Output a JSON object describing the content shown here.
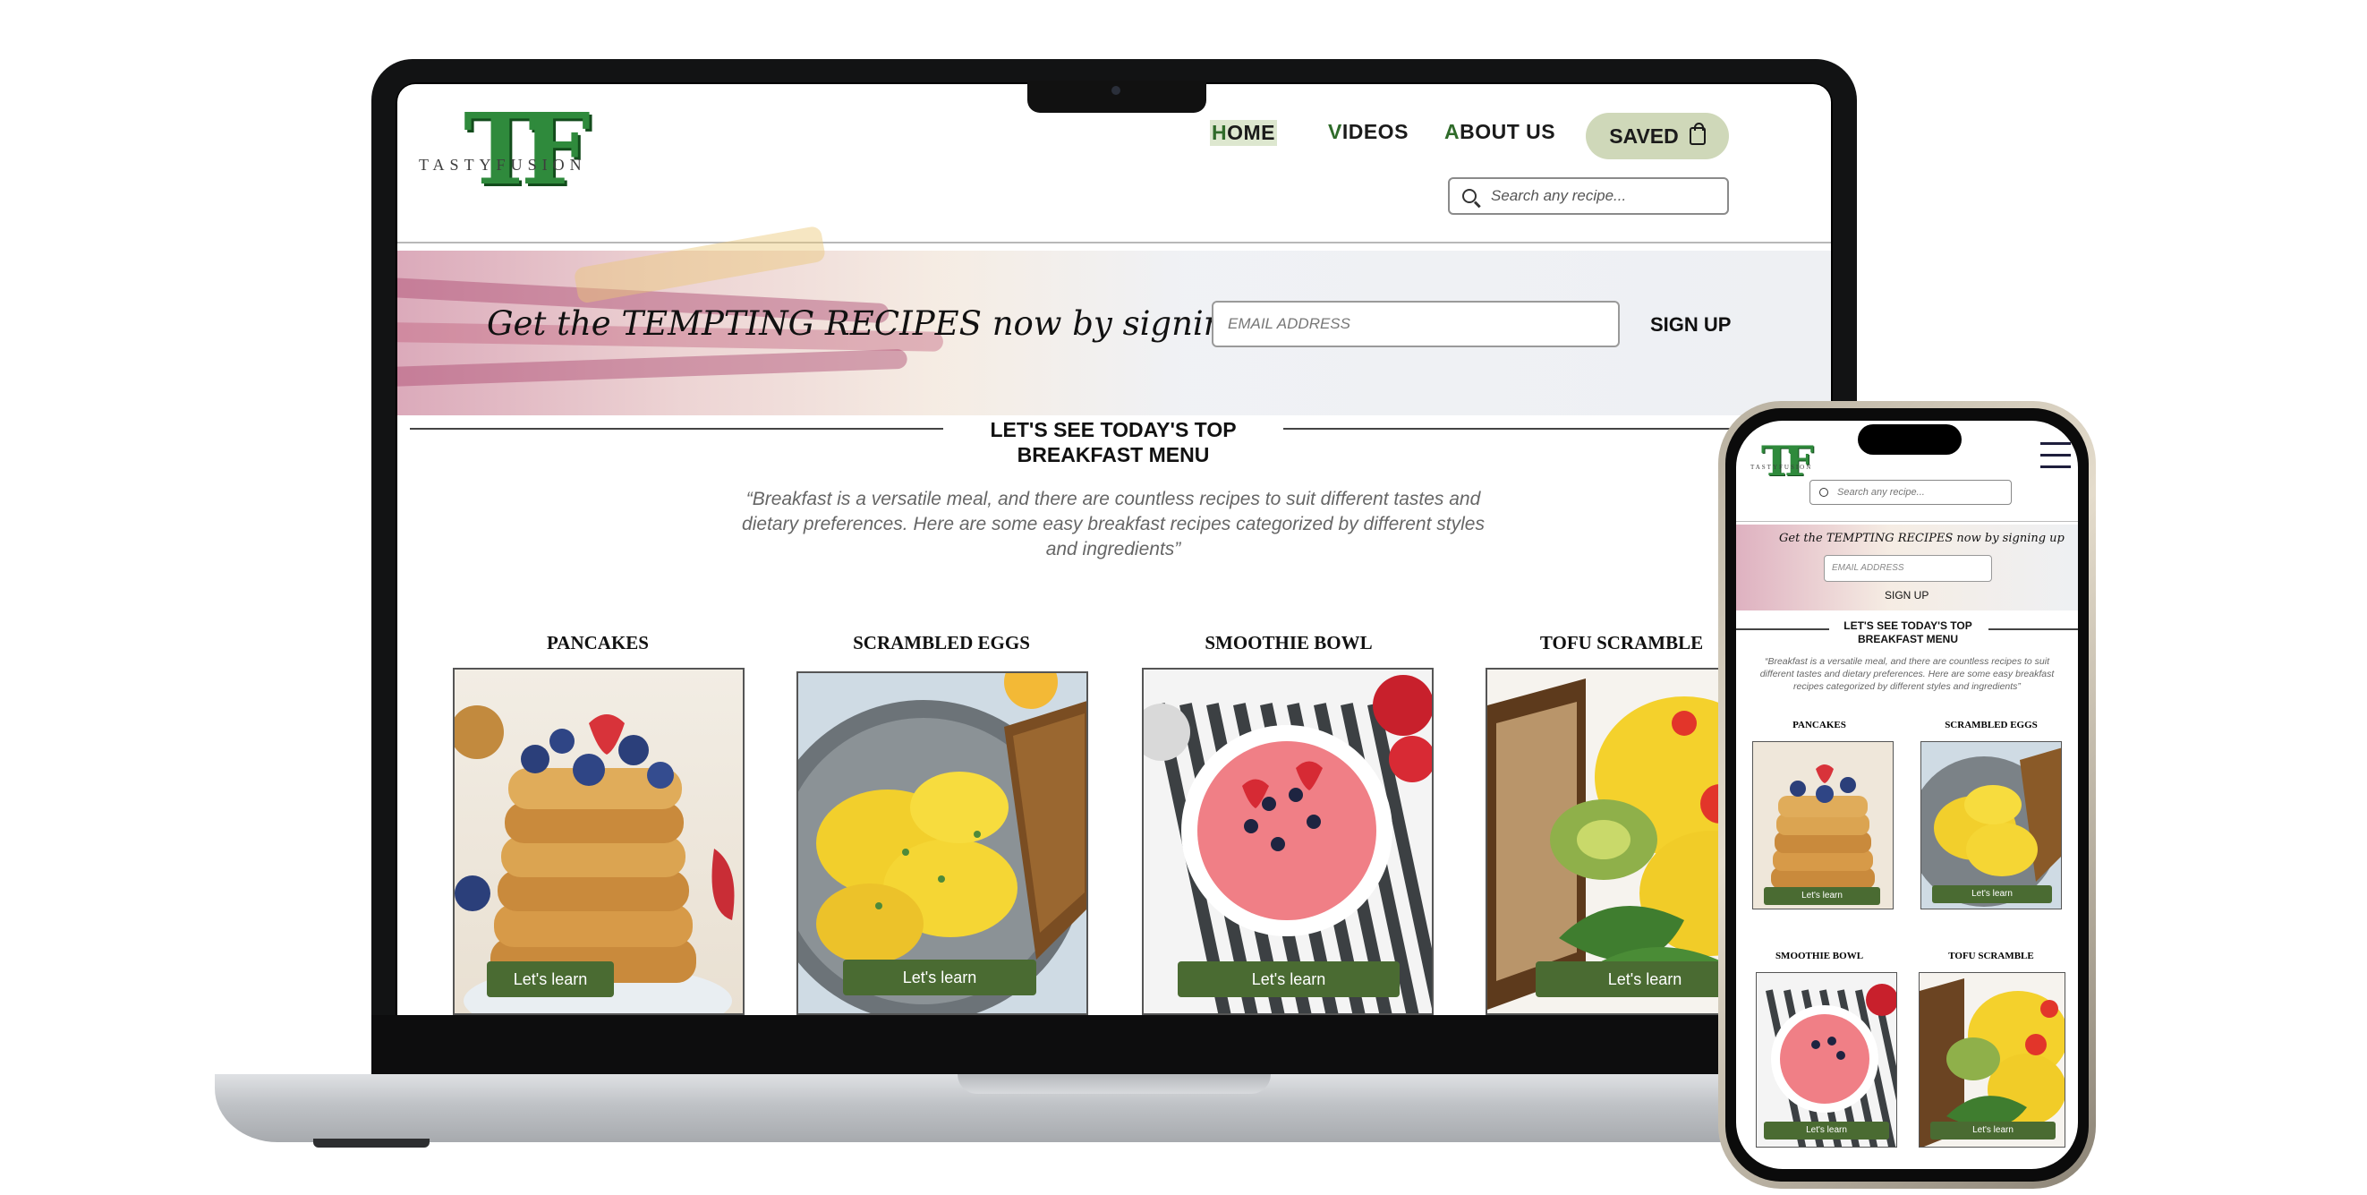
{
  "site": {
    "logo_letters": "TF",
    "logo_wordmark": "TASTYFUSION",
    "nav": [
      {
        "first": "H",
        "rest": "OME"
      },
      {
        "first": "V",
        "rest": "IDEOS"
      },
      {
        "first": "A",
        "rest": "BOUT US"
      }
    ],
    "saved_label": "SAVED",
    "search_placeholder": "Search any recipe...",
    "banner_text": "Get the TEMPTING RECIPES now by signing up",
    "email_placeholder": "EMAIL ADDRESS",
    "signup_label": "SIGN UP",
    "section_title_line1": "LET'S SEE TODAY'S TOP",
    "section_title_line2": "BREAKFAST MENU",
    "quote": "“Breakfast is a versatile meal, and there are countless recipes to suit different tastes and dietary preferences. Here are some easy breakfast recipes categorized by different styles and ingredients”",
    "cards": [
      {
        "title": "PANCAKES",
        "button": "Let's learn"
      },
      {
        "title": "SCRAMBLED EGGS",
        "button": "Let's learn"
      },
      {
        "title": "SMOOTHIE BOWL",
        "button": "Let's learn"
      },
      {
        "title": "TOFU SCRAMBLE",
        "button": "Let's learn"
      }
    ]
  },
  "colors": {
    "brand_green": "#2f8a3c",
    "button_green": "#4a6b32",
    "saved_pill": "#cfd8b9"
  },
  "icons": [
    "search-icon",
    "shopping-bag-icon",
    "hamburger-menu-icon"
  ]
}
